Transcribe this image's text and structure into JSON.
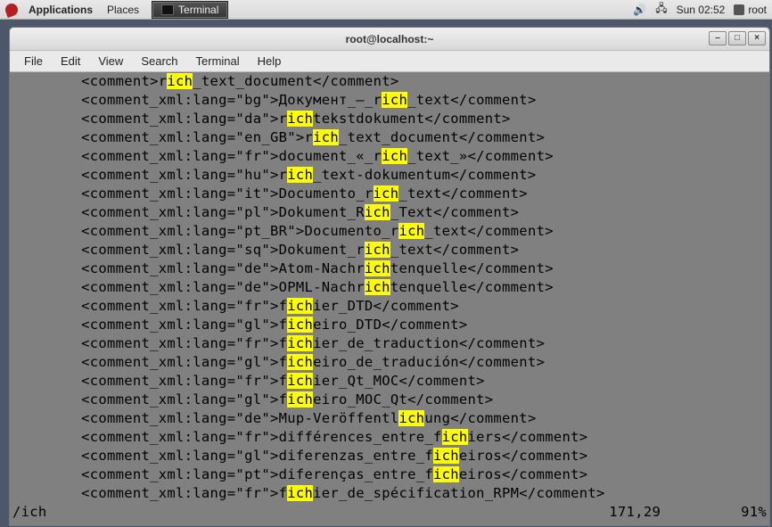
{
  "panel": {
    "applications": "Applications",
    "places": "Places",
    "task": "Terminal",
    "clock": "Sun 02:52",
    "user": "root"
  },
  "window": {
    "title": "root@localhost:~",
    "menus": {
      "file": "File",
      "edit": "Edit",
      "view": "View",
      "search": "Search",
      "terminal": "Terminal",
      "help": "Help"
    }
  },
  "highlight": "ich",
  "lead": "        ",
  "lines": [
    {
      "pre": "<comment>r",
      "post": "_text_document</comment>"
    },
    {
      "pre": "<comment_xml:lang=\"bg\">Документ_—_r",
      "post": "_text</comment>"
    },
    {
      "pre": "<comment_xml:lang=\"da\">r",
      "post": "tekstdokument</comment>"
    },
    {
      "pre": "<comment_xml:lang=\"en_GB\">r",
      "post": "_text_document</comment>"
    },
    {
      "pre": "<comment_xml:lang=\"fr\">document_«_r",
      "post": "_text_»</comment>"
    },
    {
      "pre": "<comment_xml:lang=\"hu\">r",
      "post": "_text-dokumentum</comment>"
    },
    {
      "pre": "<comment_xml:lang=\"it\">Documento_r",
      "post": "_text</comment>"
    },
    {
      "pre": "<comment_xml:lang=\"pl\">Dokument_R",
      "post": "_Text</comment>"
    },
    {
      "pre": "<comment_xml:lang=\"pt_BR\">Documento_r",
      "post": "_text</comment>"
    },
    {
      "pre": "<comment_xml:lang=\"sq\">Dokument_r",
      "post": "_text</comment>"
    },
    {
      "pre": "<comment_xml:lang=\"de\">Atom-Nachr",
      "post": "tenquelle</comment>"
    },
    {
      "pre": "<comment_xml:lang=\"de\">OPML-Nachr",
      "post": "tenquelle</comment>"
    },
    {
      "pre": "<comment_xml:lang=\"fr\">f",
      "post": "ier_DTD</comment>"
    },
    {
      "pre": "<comment_xml:lang=\"gl\">f",
      "post": "eiro_DTD</comment>"
    },
    {
      "pre": "<comment_xml:lang=\"fr\">f",
      "post": "ier_de_traduction</comment>"
    },
    {
      "pre": "<comment_xml:lang=\"gl\">f",
      "post": "eiro_de_tradución</comment>"
    },
    {
      "pre": "<comment_xml:lang=\"fr\">f",
      "post": "ier_Qt_MOC</comment>"
    },
    {
      "pre": "<comment_xml:lang=\"gl\">f",
      "post": "eiro_MOC_Qt</comment>"
    },
    {
      "pre": "<comment_xml:lang=\"de\">Mup-Veröffentl",
      "post": "ung</comment>"
    },
    {
      "pre": "<comment_xml:lang=\"fr\">différences_entre_f",
      "post": "iers</comment>"
    },
    {
      "pre": "<comment_xml:lang=\"gl\">diferenzas_entre_f",
      "post": "eiros</comment>"
    },
    {
      "pre": "<comment_xml:lang=\"pt\">diferenças_entre_f",
      "post": "eiros</comment>"
    },
    {
      "pre": "<comment_xml:lang=\"fr\">f",
      "post": "ier_de_spécification_RPM</comment>"
    }
  ],
  "status": {
    "search": "/ich",
    "pos": "171,29",
    "pct": "91%"
  }
}
